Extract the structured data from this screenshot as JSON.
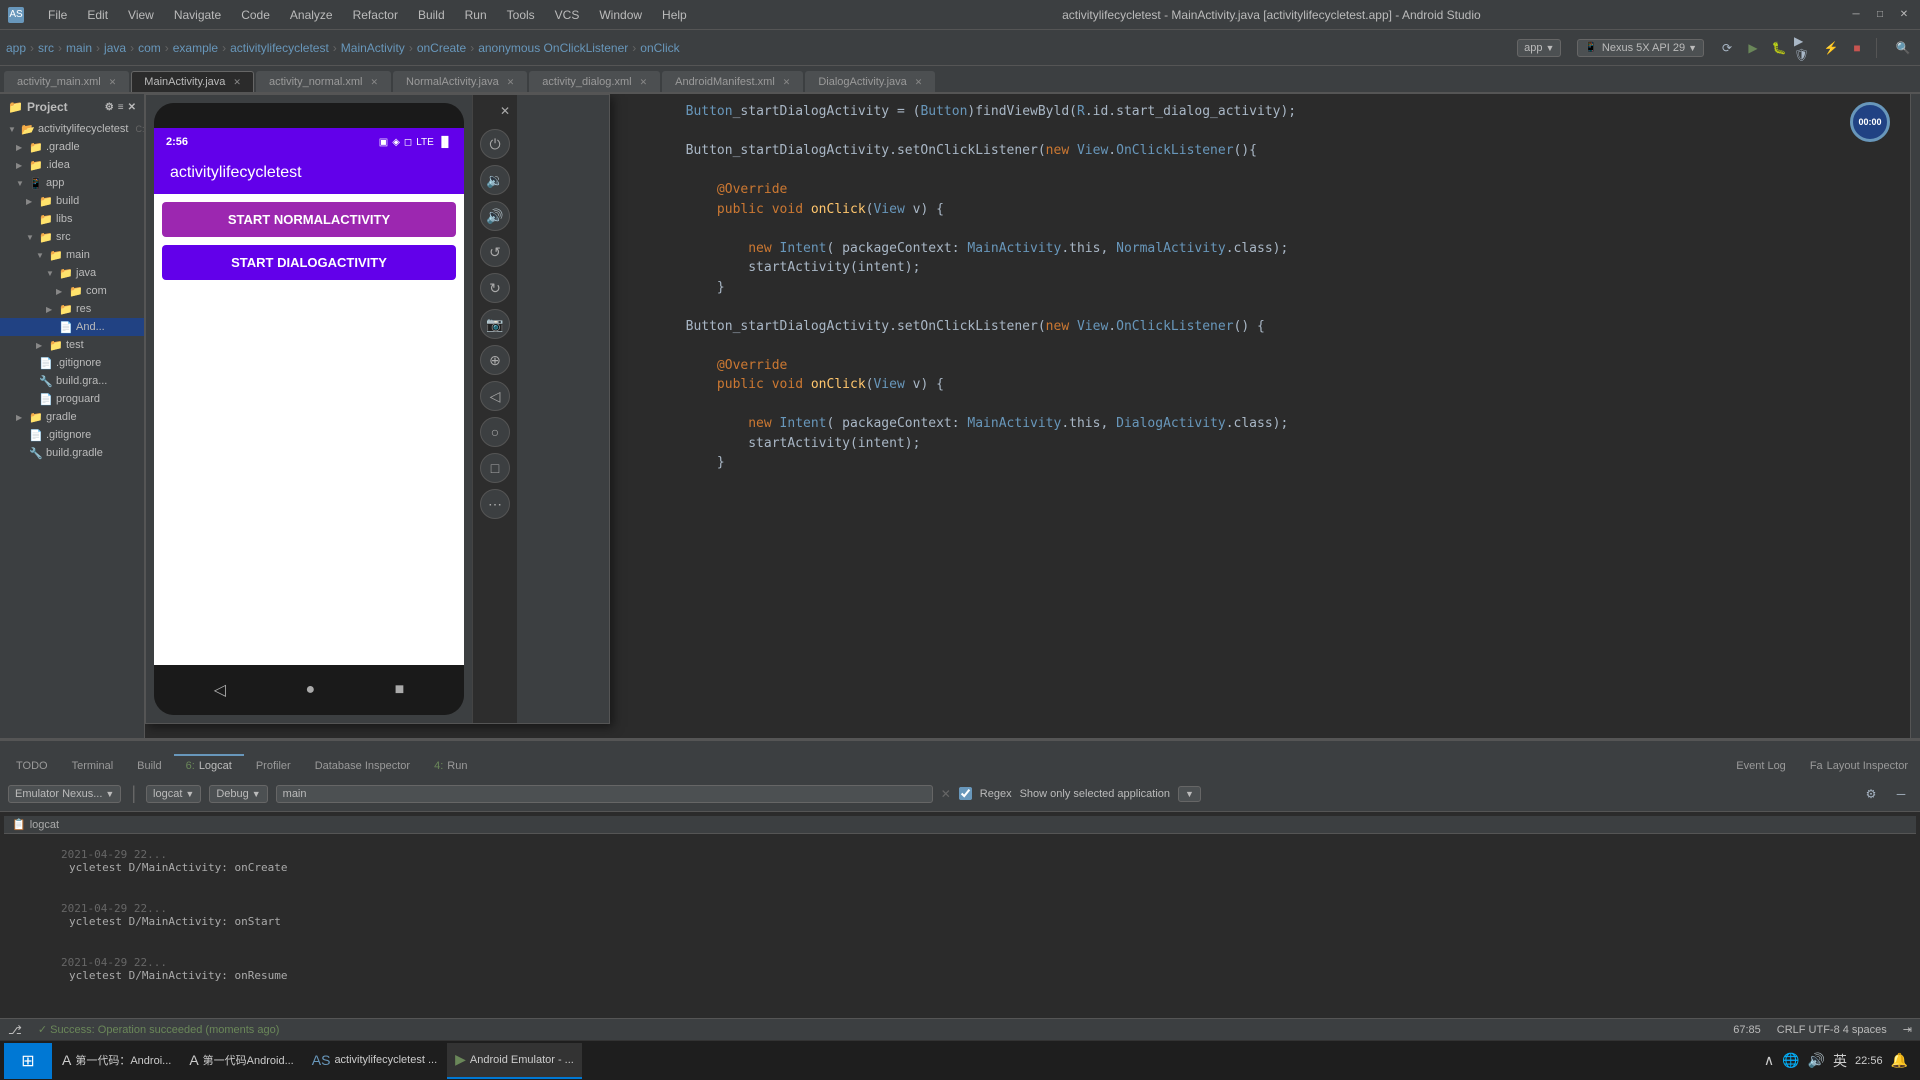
{
  "titleBar": {
    "title": "activitylifecycletest - MainActivity.java [activitylifecycletest.app] - Android Studio",
    "menus": [
      "File",
      "Edit",
      "View",
      "Navigate",
      "Code",
      "Analyze",
      "Refactor",
      "Build",
      "Run",
      "Tools",
      "VCS",
      "Window",
      "Help"
    ]
  },
  "breadcrumb": {
    "items": [
      "app",
      "src",
      "main",
      "java",
      "com",
      "example",
      "activitylifecycletest",
      "MainActivity",
      "onCreate",
      "anonymous OnClickListener",
      "onClick"
    ]
  },
  "tabs": [
    {
      "label": "activity_main.xml",
      "active": false
    },
    {
      "label": "MainActivity.java",
      "active": true
    },
    {
      "label": "activity_normal.xml",
      "active": false
    },
    {
      "label": "NormalActivity.java",
      "active": false
    },
    {
      "label": "activity_dialog.xml",
      "active": false
    },
    {
      "label": "AndroidManifest.xml",
      "active": false
    },
    {
      "label": "DialogActivity.java",
      "active": false
    }
  ],
  "toolbar": {
    "appDropdown": "app",
    "deviceDropdown": "Nexus 5X API 29",
    "runLabel": "Run",
    "debugLabel": "Debug"
  },
  "sidebar": {
    "title": "Project",
    "items": [
      {
        "label": "activitylifecycletest",
        "indent": 0,
        "hasArrow": true,
        "expanded": true
      },
      {
        "label": ".gradle",
        "indent": 1,
        "hasArrow": true,
        "expanded": false
      },
      {
        "label": ".idea",
        "indent": 1,
        "hasArrow": true,
        "expanded": false
      },
      {
        "label": "app",
        "indent": 1,
        "hasArrow": true,
        "expanded": true
      },
      {
        "label": "build",
        "indent": 2,
        "hasArrow": true,
        "expanded": false
      },
      {
        "label": "libs",
        "indent": 2,
        "hasArrow": false,
        "expanded": false
      },
      {
        "label": "src",
        "indent": 2,
        "hasArrow": true,
        "expanded": true
      },
      {
        "label": "main",
        "indent": 3,
        "hasArrow": true,
        "expanded": true
      },
      {
        "label": "java",
        "indent": 4,
        "hasArrow": true,
        "expanded": true
      },
      {
        "label": "com",
        "indent": 5,
        "hasArrow": true,
        "expanded": false
      },
      {
        "label": "res",
        "indent": 4,
        "hasArrow": true,
        "expanded": false
      },
      {
        "label": "And...",
        "indent": 4,
        "hasArrow": false,
        "selected": true
      },
      {
        "label": "test",
        "indent": 3,
        "hasArrow": true,
        "expanded": false
      },
      {
        "label": ".gitignore",
        "indent": 2,
        "hasArrow": false
      },
      {
        "label": "build.gra...",
        "indent": 2,
        "hasArrow": false
      },
      {
        "label": "proguard-...",
        "indent": 2,
        "hasArrow": false
      },
      {
        "label": "gradle",
        "indent": 1,
        "hasArrow": true,
        "expanded": false
      },
      {
        "label": ".gitignore",
        "indent": 1,
        "hasArrow": false
      },
      {
        "label": "build.gradle",
        "indent": 1,
        "hasArrow": false
      }
    ]
  },
  "code": {
    "lines": [
      {
        "num": "",
        "text": "Button_startDialogActivity = (Button)findViewById(R.id.start_dialog_activity);"
      },
      {
        "num": "",
        "text": ""
      },
      {
        "num": "",
        "text": "Button_startDialogActivity.setOnClickListener(new View.OnClickListener(){"
      },
      {
        "num": "",
        "text": ""
      },
      {
        "num": "",
        "text": "    @Override"
      },
      {
        "num": "",
        "text": "    public void onClick(View v) {"
      },
      {
        "num": "",
        "text": ""
      },
      {
        "num": "",
        "text": "        new Intent( packageContext: MainActivity.this, NormalActivity.class);"
      },
      {
        "num": "",
        "text": "        startActivity(intent);"
      },
      {
        "num": "",
        "text": "    }"
      },
      {
        "num": "",
        "text": ""
      },
      {
        "num": "",
        "text": "Button_startDialogActivity.setOnClickListener(new View.OnClickListener() {"
      },
      {
        "num": "",
        "text": ""
      },
      {
        "num": "",
        "text": "    @Override"
      },
      {
        "num": "",
        "text": "    public void onClick(View v) {"
      },
      {
        "num": "",
        "text": ""
      },
      {
        "num": "",
        "text": "        new Intent( packageContext: MainActivity.this, DialogActivity.class);"
      },
      {
        "num": "",
        "text": "        startActivity(intent);"
      },
      {
        "num": "",
        "text": "    }"
      }
    ]
  },
  "emulator": {
    "closeBtn": "✕",
    "device": {
      "time": "2:56",
      "appTitle": "activitylifecycletest",
      "buttons": [
        {
          "label": "START NORMALACTIVITY",
          "type": "normal"
        },
        {
          "label": "START DIALOGACTIVITY",
          "type": "dialog"
        }
      ],
      "navButtons": [
        "◁",
        "●",
        "■"
      ]
    },
    "controls": [
      "⏻",
      "🔇",
      "🔊",
      "◈",
      "◈",
      "📷",
      "⊕",
      "◁",
      "○",
      "□",
      "⋯"
    ]
  },
  "logcat": {
    "title": "Logcat",
    "filterEmulator": "Emulator Nexus...",
    "filterProcess": "logcat",
    "filterLevel": "Debug",
    "filterSearch": "main",
    "showOnlySelected": "Show only selected application",
    "regexLabel": "Regex",
    "lines": [
      {
        "text": "2021-04-29 22...   ycletest D/MainActivity: onCreate"
      },
      {
        "text": "2021-04-29 22...   ycletest D/MainActivity: onStart"
      },
      {
        "text": "2021-04-29 22...   ycletest D/MainActivity: onResume"
      }
    ]
  },
  "bottomTabs": [
    {
      "label": "TODO",
      "active": false
    },
    {
      "label": "Terminal",
      "active": false
    },
    {
      "label": "Build",
      "active": false
    },
    {
      "label": "6: Logcat",
      "active": true
    },
    {
      "label": "Profiler",
      "active": false
    },
    {
      "label": "Database Inspector",
      "active": false
    },
    {
      "label": "4: Run",
      "active": false
    }
  ],
  "rightTabs": [
    {
      "label": "Event Log"
    },
    {
      "label": "Layout Inspector"
    }
  ],
  "statusBar": {
    "message": "✓ Success: Operation succeeded (moments ago)",
    "position": "67:85",
    "encoding": "CRLF  UTF-8  4 spaces"
  },
  "runIndicator": "00:00",
  "taskbar": {
    "items": [
      {
        "label": "第一代码：Androi...",
        "active": false,
        "icon": "A"
      },
      {
        "label": "第一代码Android...",
        "active": false,
        "icon": "A"
      },
      {
        "label": "activitylifecycletest ...",
        "active": false,
        "icon": "AS"
      },
      {
        "label": "Android Emulator - ...",
        "active": true,
        "icon": "AE"
      }
    ],
    "tray": {
      "time": "22:56",
      "lang": "英"
    }
  }
}
